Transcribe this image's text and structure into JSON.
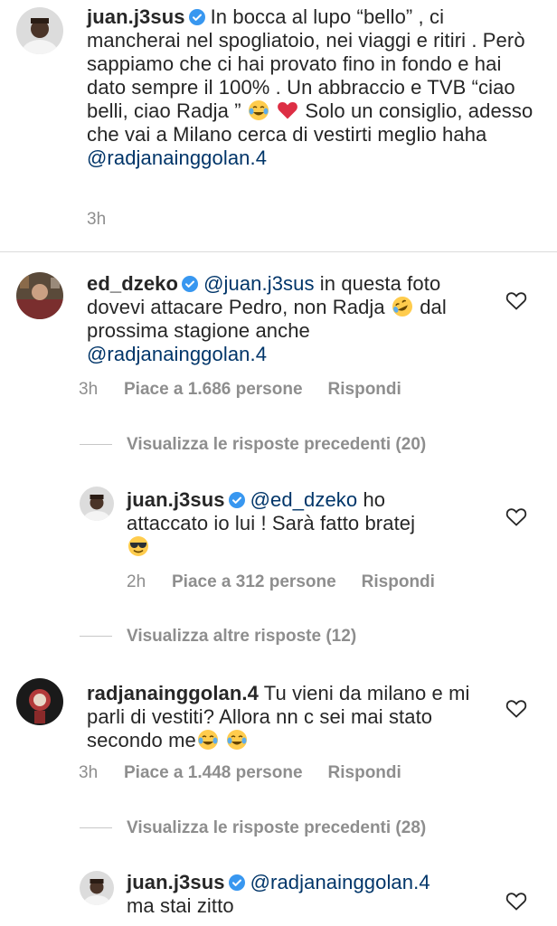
{
  "comments": [
    {
      "username": "juan.j3sus",
      "text_1": "In bocca al lupo “bello” , ci mancherai nel spogliatoio, nei viaggi e ritiri . Però sappiamo che ci hai provato fino in fondo e hai dato sempre il 100% . Un abbraccio e TVB “ciao belli, ciao Radja ”",
      "text_2": "Solo un consiglio, adesso che vai a Milano cerca di vestirti meglio haha",
      "mention": "@radjanainggolan.4",
      "time": "3h"
    },
    {
      "username": "ed_dzeko",
      "mention_1": "@juan.j3sus",
      "text_1": "in questa foto dovevi attacare Pedro, non Radja",
      "text_2": "dal prossima stagione anche",
      "mention_2": "@radjanainggolan.4",
      "time": "3h",
      "likes": "Piace a 1.686 persone",
      "reply": "Rispondi"
    },
    {
      "username": "juan.j3sus",
      "mention_1": "@ed_dzeko",
      "text_1": "ho attaccato io lui ! Sarà fatto bratej",
      "time": "2h",
      "likes": "Piace a 312 persone",
      "reply": "Rispondi"
    },
    {
      "username": "radjanainggolan.4",
      "text_1": "Tu vieni da milano e mi parli di vestiti? Allora nn c sei mai stato secondo me",
      "time": "3h",
      "likes": "Piace a 1.448 persone",
      "reply": "Rispondi"
    },
    {
      "username": "juan.j3sus",
      "mention_1": "@radjanainggolan.4",
      "text_1": "ma stai zitto"
    }
  ],
  "view_replies": {
    "previous_20": "Visualizza le risposte precedenti (20)",
    "other_12": "Visualizza altre risposte (12)",
    "previous_28": "Visualizza le risposte precedenti (28)"
  },
  "icons": {
    "verified": "verified-badge-icon",
    "heart": "heart-outline-icon",
    "emoji_laugh": "face-with-tears-of-joy-icon",
    "emoji_rofl": "rolling-on-floor-laughing-icon",
    "emoji_cool": "smiling-face-with-sunglasses-icon",
    "emoji_heart": "red-heart-icon"
  },
  "colors": {
    "text": "#262626",
    "secondary": "#8e8e8e",
    "mention": "#003569",
    "verified": "#3897f0",
    "divider": "#dbdbdb"
  }
}
